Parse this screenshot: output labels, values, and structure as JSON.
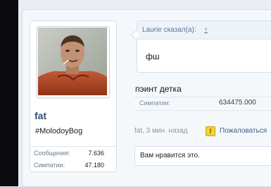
{
  "post": {
    "author": {
      "username": "fat",
      "user_title": "#MolodoyBog",
      "stats": [
        {
          "label": "Сообщения:",
          "value": "7.636"
        },
        {
          "label": "Симпатии:",
          "value": "47.180"
        }
      ]
    },
    "quote": {
      "author": "Laurie сказал(а):",
      "link": "↑",
      "text": "фш"
    },
    "message": "пэинт детка",
    "field": {
      "label": "Симпатии:",
      "value": "634475.000"
    },
    "meta": "fat, 3 мин. назад",
    "report_label": "Пожаловаться",
    "likes_text": "Вам нравится это."
  },
  "colors": {
    "accent": "#2c4e73",
    "warning": "#f2d431"
  },
  "icons": {
    "warning": "warning-icon",
    "avatar": "user-avatar"
  }
}
